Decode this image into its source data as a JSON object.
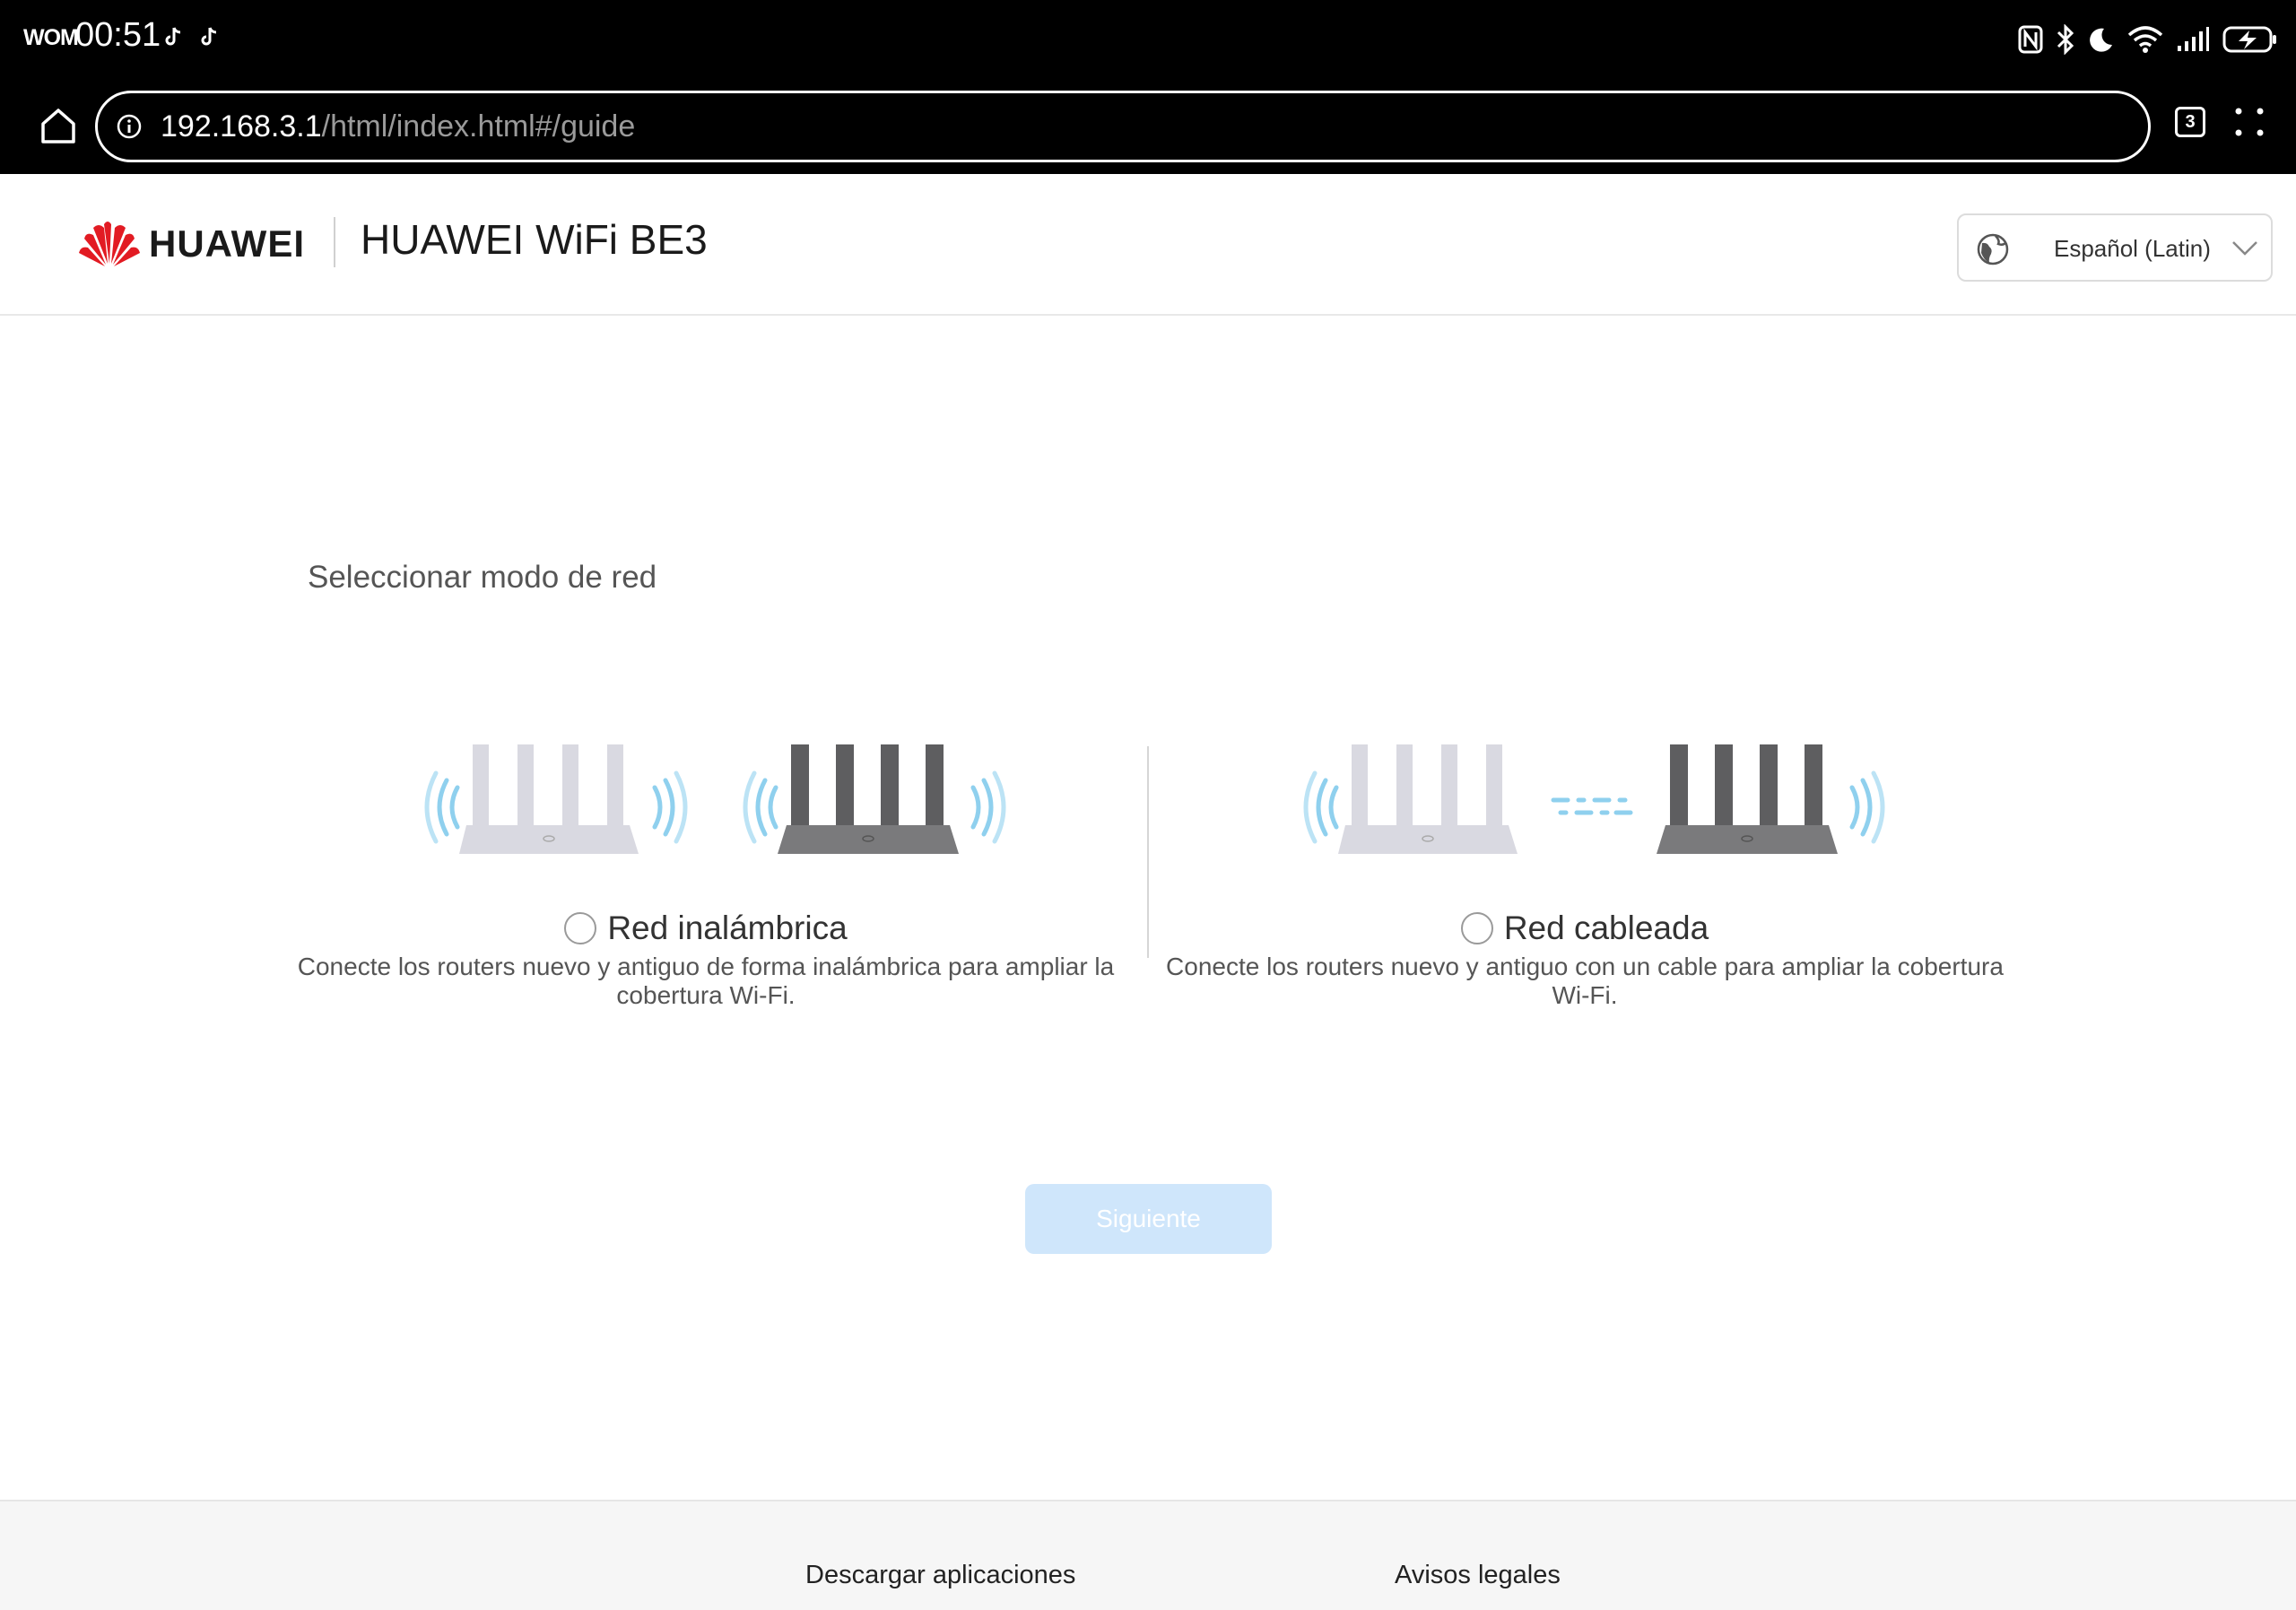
{
  "status_bar": {
    "carrier": "WOM",
    "time": "00:51",
    "notification_icons": [
      "tiktok-icon",
      "tiktok-icon"
    ],
    "system_icons": [
      "nfc-icon",
      "bluetooth-icon",
      "do-not-disturb-icon",
      "wifi-icon",
      "signal-icon",
      "battery-charging-icon"
    ]
  },
  "browser": {
    "url_host": "192.168.3.1",
    "url_path": "/html/index.html#/guide",
    "tab_count": "3"
  },
  "header": {
    "brand": "HUAWEI",
    "product_name": "HUAWEI WiFi BE3",
    "language": "Español (Latin)"
  },
  "main": {
    "title": "Seleccionar modo de red",
    "options": [
      {
        "label": "Red inalámbrica",
        "description": "Conecte los routers nuevo y antiguo de forma inalámbrica para ampliar la cobertura Wi-Fi.",
        "selected": false
      },
      {
        "label": "Red cableada",
        "description": "Conecte los routers nuevo y antiguo con un cable para ampliar la cobertura Wi-Fi.",
        "selected": false
      }
    ],
    "next_button": "Siguiente",
    "next_enabled": false
  },
  "footer": {
    "col1_title": "Descargar aplicaciones",
    "col2_title": "Avisos legales"
  },
  "colors": {
    "accent_disabled": "#cfe6fb",
    "wave_blue": "#8fd0ee",
    "router_light": "#d9d9e1",
    "router_dark": "#5e5e60"
  }
}
